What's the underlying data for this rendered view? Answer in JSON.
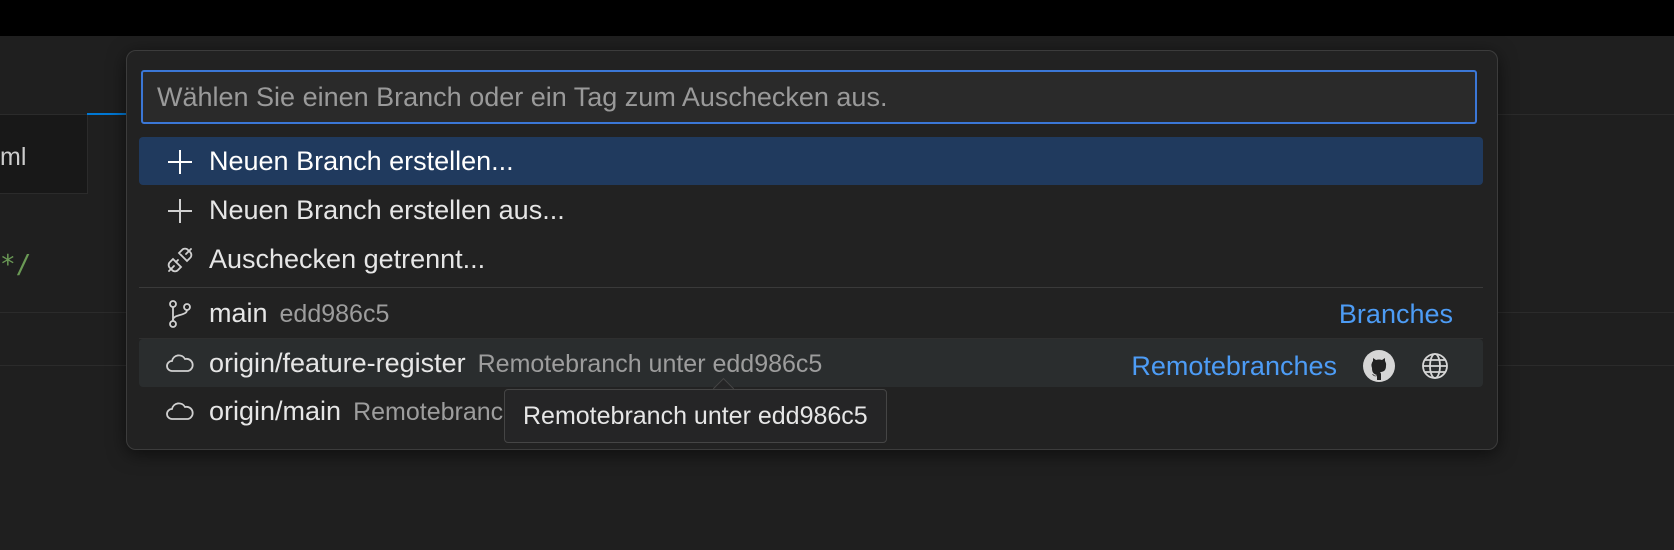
{
  "editor": {
    "tab_label": "ml",
    "code_fragment": "*/"
  },
  "quick_pick": {
    "placeholder": "Wählen Sie einen Branch oder ein Tag zum Auschecken aus.",
    "actions": [
      {
        "label": "Neuen Branch erstellen...",
        "icon": "plus-icon"
      },
      {
        "label": "Neuen Branch erstellen aus...",
        "icon": "plus-icon"
      },
      {
        "label": "Auschecken getrennt...",
        "icon": "debug-disconnect-icon"
      }
    ],
    "branches": [
      {
        "name": "main",
        "description": "edd986c5",
        "group": "Branches",
        "icon": "git-branch-icon"
      },
      {
        "name": "origin/feature-register",
        "description": "Remotebranch unter edd986c5",
        "group": "Remotebranches",
        "icon": "cloud-icon"
      },
      {
        "name": "origin/main",
        "description": "Remotebranch unter edd986c5",
        "icon": "cloud-icon"
      }
    ]
  },
  "tooltip": {
    "text": "Remotebranch unter edd986c5"
  },
  "colors": {
    "accent": "#3b77d6",
    "selection": "#203a5e",
    "group_label": "#4d9cf5"
  }
}
